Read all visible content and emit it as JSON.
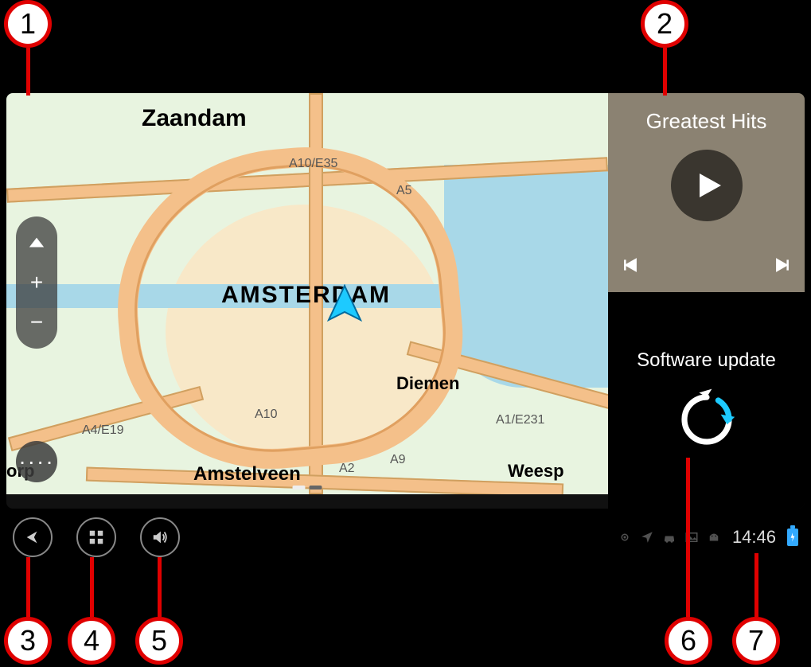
{
  "callouts": {
    "c1": "1",
    "c2": "2",
    "c3": "3",
    "c4": "4",
    "c5": "5",
    "c6": "6",
    "c7": "7"
  },
  "map": {
    "cities": {
      "zaandam": "Zaandam",
      "amsterdam": "AMSTERDAM",
      "diemen": "Diemen",
      "amstelveen": "Amstelveen",
      "weesp": "Weesp",
      "orp": "orp"
    },
    "roads": {
      "a10e35": "A10/E35",
      "a5": "A5",
      "a10": "A10",
      "a4e19": "A4/E19",
      "a1e231": "A1/E231",
      "a2": "A2",
      "a9": "A9"
    },
    "controls": {
      "zoom_in": "+",
      "zoom_out": "−",
      "more": "····"
    }
  },
  "media": {
    "title": "Greatest Hits"
  },
  "update": {
    "title": "Software update"
  },
  "system": {
    "time": "14:46"
  }
}
